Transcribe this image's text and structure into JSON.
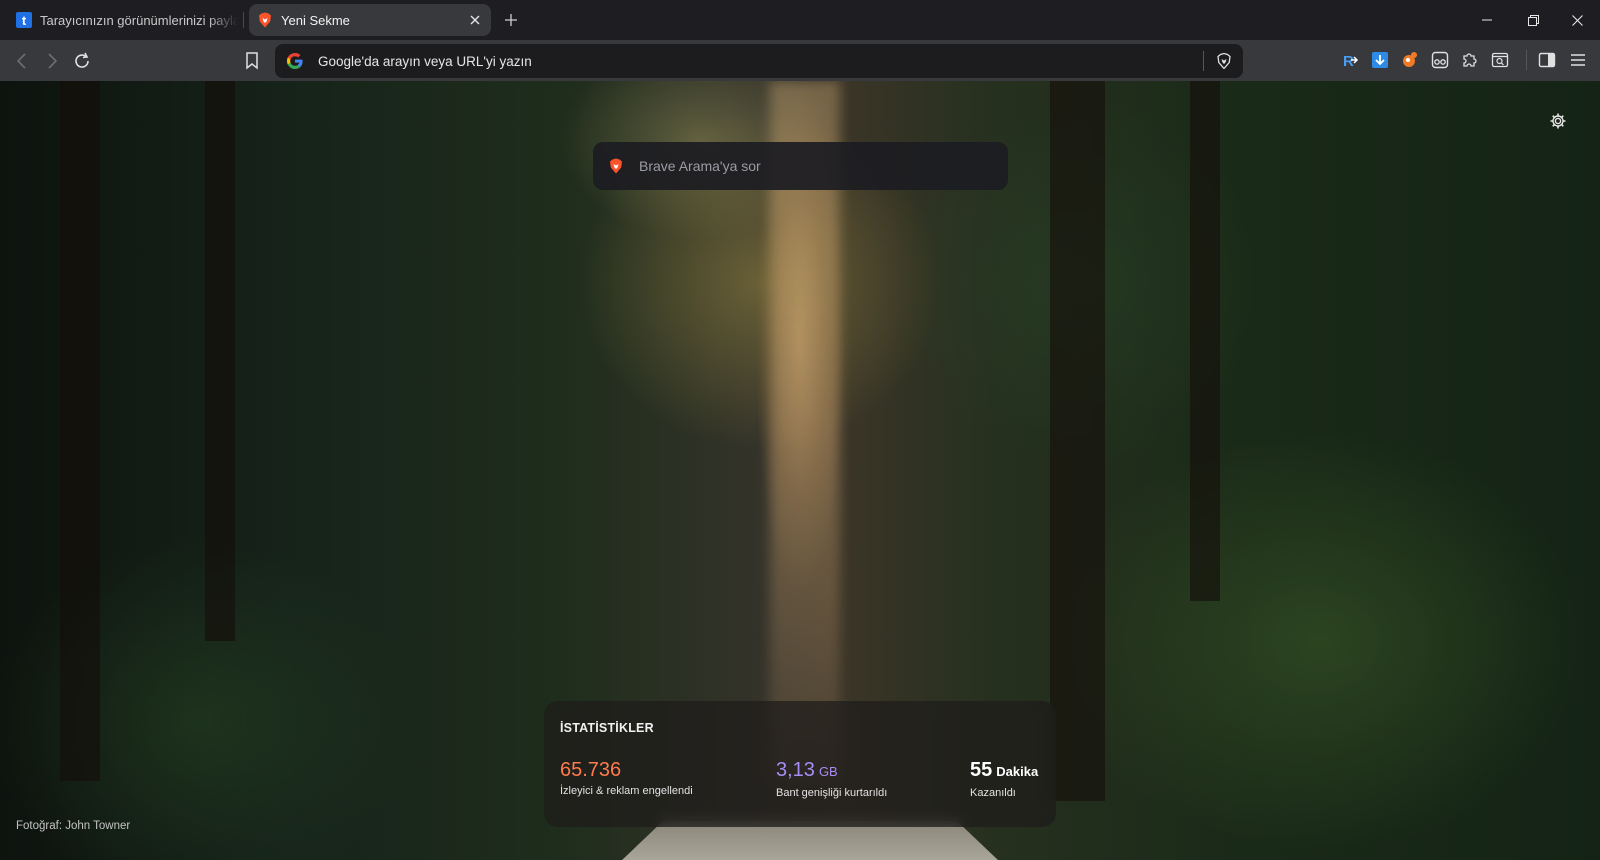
{
  "tabs": [
    {
      "title": "Tarayıcınızın görünümlerinizi paylaşın",
      "favicon": "t-letter-icon",
      "active": false
    },
    {
      "title": "Yeni Sekme",
      "favicon": "brave-lion-icon",
      "active": true
    }
  ],
  "toolbar": {
    "omnibox_placeholder": "Google'da arayın veya URL'yi yazın"
  },
  "newtab": {
    "search_placeholder": "Brave Arama'ya sor",
    "photo_credit": "Fotoğraf: John Towner",
    "stats": {
      "heading": "İSTATİSTİKLER",
      "trackers": {
        "value": "65.736",
        "label": "İzleyici & reklam engellendi"
      },
      "bandwidth": {
        "value": "3,13",
        "unit": "GB",
        "label": "Bant genişliği kurtarıldı"
      },
      "time": {
        "value": "55",
        "unit": "Dakika",
        "label": "Kazanıldı"
      }
    }
  },
  "colors": {
    "brave_orange": "#fb542b",
    "trackers_color": "#ff7a4d",
    "bandwidth_color": "#a68cf4"
  }
}
